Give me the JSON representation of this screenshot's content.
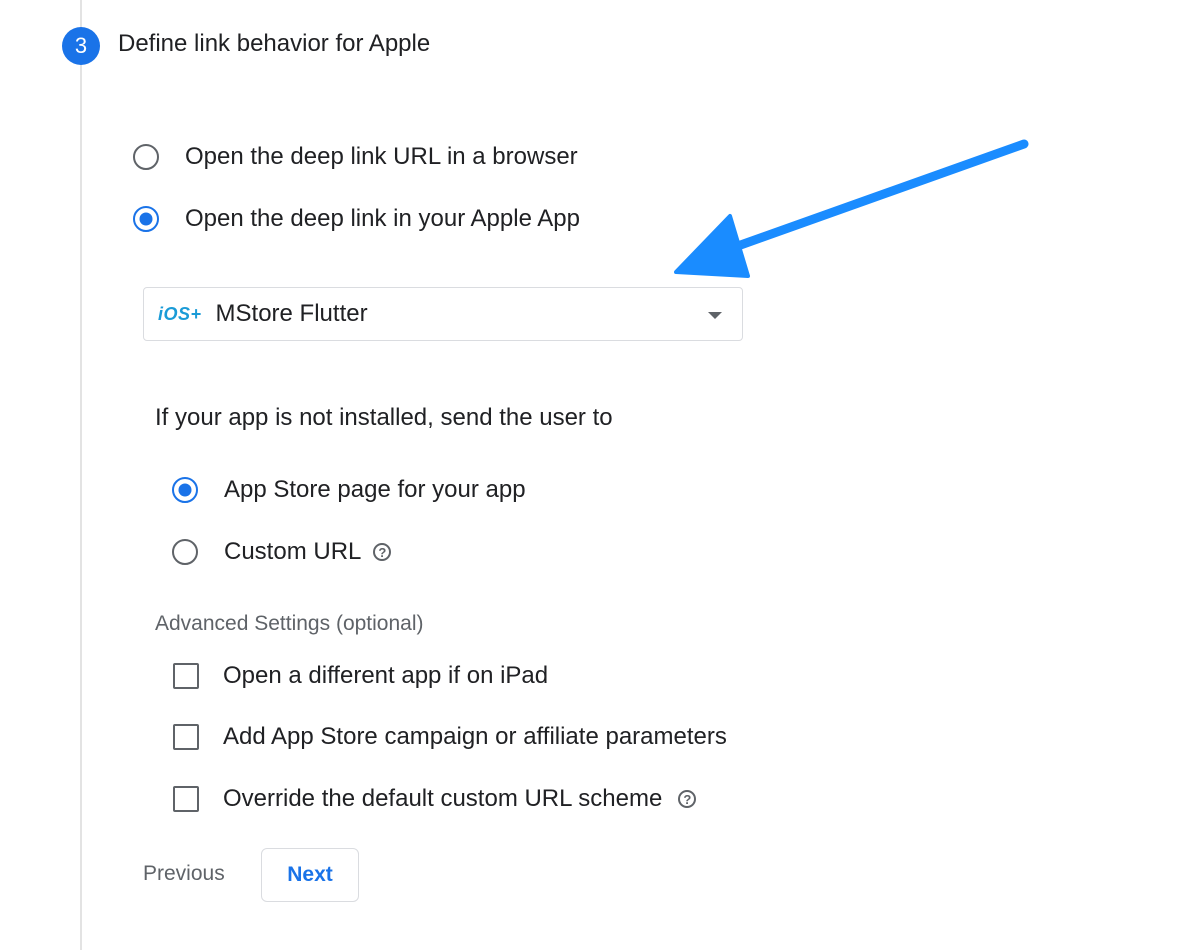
{
  "step": {
    "number": "3",
    "title": "Define link behavior for Apple"
  },
  "link_behavior": {
    "options": [
      {
        "label": "Open the deep link URL in a browser",
        "checked": false
      },
      {
        "label": "Open the deep link in your Apple App",
        "checked": true
      }
    ]
  },
  "app_select": {
    "platform_badge": "iOS+",
    "value": "MStore Flutter"
  },
  "not_installed": {
    "label": "If your app is not installed, send the user to",
    "options": [
      {
        "label": "App Store page for your app",
        "checked": true
      },
      {
        "label": "Custom URL",
        "checked": false,
        "help": "?"
      }
    ]
  },
  "advanced": {
    "label": "Advanced Settings (optional)",
    "options": [
      {
        "label": "Open a different app if on iPad",
        "checked": false
      },
      {
        "label": "Add App Store campaign or affiliate parameters",
        "checked": false
      },
      {
        "label": "Override the default custom URL scheme",
        "checked": false,
        "help": "?"
      }
    ]
  },
  "nav": {
    "previous": "Previous",
    "next": "Next"
  },
  "colors": {
    "accent": "#1a73e8",
    "annotation_arrow": "#1a8cff"
  }
}
